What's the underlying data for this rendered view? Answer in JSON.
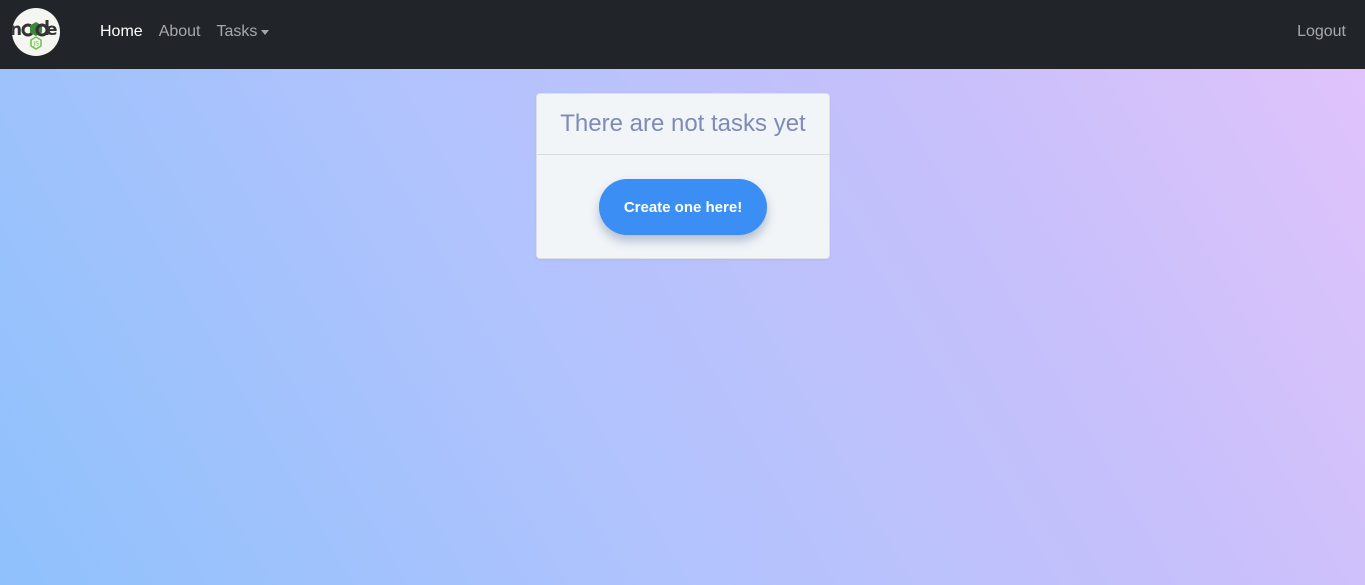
{
  "navbar": {
    "logo_alt": "node",
    "links": [
      {
        "label": "Home",
        "active": true
      },
      {
        "label": "About",
        "active": false
      },
      {
        "label": "Tasks",
        "active": false,
        "dropdown": true
      }
    ],
    "logout_label": "Logout"
  },
  "card": {
    "title": "There are not tasks yet",
    "button_label": "Create one here!"
  },
  "colors": {
    "navbar_bg": "#212529",
    "button_bg": "#3b8ef3",
    "card_bg": "#f1f5f8",
    "title_color": "#7f8bb6"
  }
}
